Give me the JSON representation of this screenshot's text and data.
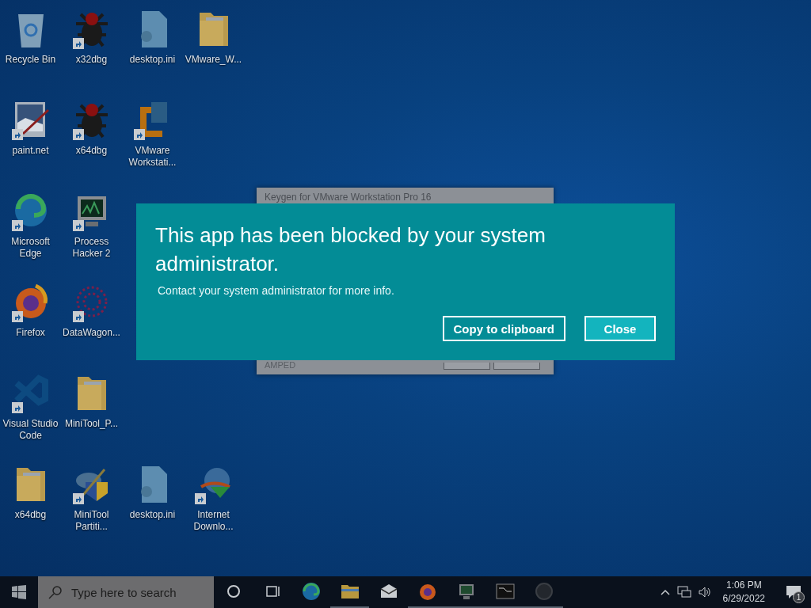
{
  "desktop": {
    "rows": [
      [
        {
          "label": "Recycle Bin",
          "kind": "recycle",
          "shortcut": false
        },
        {
          "label": "x32dbg",
          "kind": "bug",
          "shortcut": true
        },
        {
          "label": "desktop.ini",
          "kind": "file",
          "shortcut": false
        },
        {
          "label": "VMware_W...",
          "kind": "folder",
          "shortcut": false
        }
      ],
      [
        {
          "label": "paint.net",
          "kind": "paint",
          "shortcut": true
        },
        {
          "label": "x64dbg",
          "kind": "bug",
          "shortcut": true
        },
        {
          "label": "VMware Workstati...",
          "kind": "vmware",
          "shortcut": true
        }
      ],
      [
        {
          "label": "Microsoft Edge",
          "kind": "edge",
          "shortcut": true
        },
        {
          "label": "Process Hacker 2",
          "kind": "monitor",
          "shortcut": true
        }
      ],
      [
        {
          "label": "Firefox",
          "kind": "firefox",
          "shortcut": true
        },
        {
          "label": "DataWagon...",
          "kind": "web",
          "shortcut": true
        }
      ],
      [
        {
          "label": "Visual Studio Code",
          "kind": "vscode",
          "shortcut": true
        },
        {
          "label": "MiniTool_P...",
          "kind": "folder",
          "shortcut": false
        }
      ],
      [
        {
          "label": "x64dbg",
          "kind": "folder",
          "shortcut": false
        },
        {
          "label": "MiniTool Partiti...",
          "kind": "partition",
          "shortcut": true
        },
        {
          "label": "desktop.ini",
          "kind": "file",
          "shortcut": false
        },
        {
          "label": "Internet Downlo...",
          "kind": "globe",
          "shortcut": true
        }
      ]
    ]
  },
  "background_window": {
    "title": "Keygen for VMware Workstation Pro 16",
    "footer_text": "AMPED"
  },
  "dialog": {
    "title": "This app has been blocked by your system administrator.",
    "message": "Contact your system administrator for more info.",
    "buttons": [
      {
        "label": "Copy to clipboard",
        "default": false
      },
      {
        "label": "Close",
        "default": true
      }
    ]
  },
  "taskbar": {
    "search": {
      "placeholder": "Type here to search"
    },
    "apps": [
      {
        "kind": "cortana",
        "running": false
      },
      {
        "kind": "taskview",
        "running": false
      },
      {
        "kind": "edge",
        "running": false
      },
      {
        "kind": "explorer",
        "running": true
      },
      {
        "kind": "mail",
        "running": false
      },
      {
        "kind": "firefox",
        "running": true
      },
      {
        "kind": "monitor",
        "running": true
      },
      {
        "kind": "terminal",
        "running": true
      },
      {
        "kind": "circle",
        "running": true
      }
    ],
    "time": "1:06 PM",
    "date": "6/29/2022",
    "notifications": "1"
  }
}
